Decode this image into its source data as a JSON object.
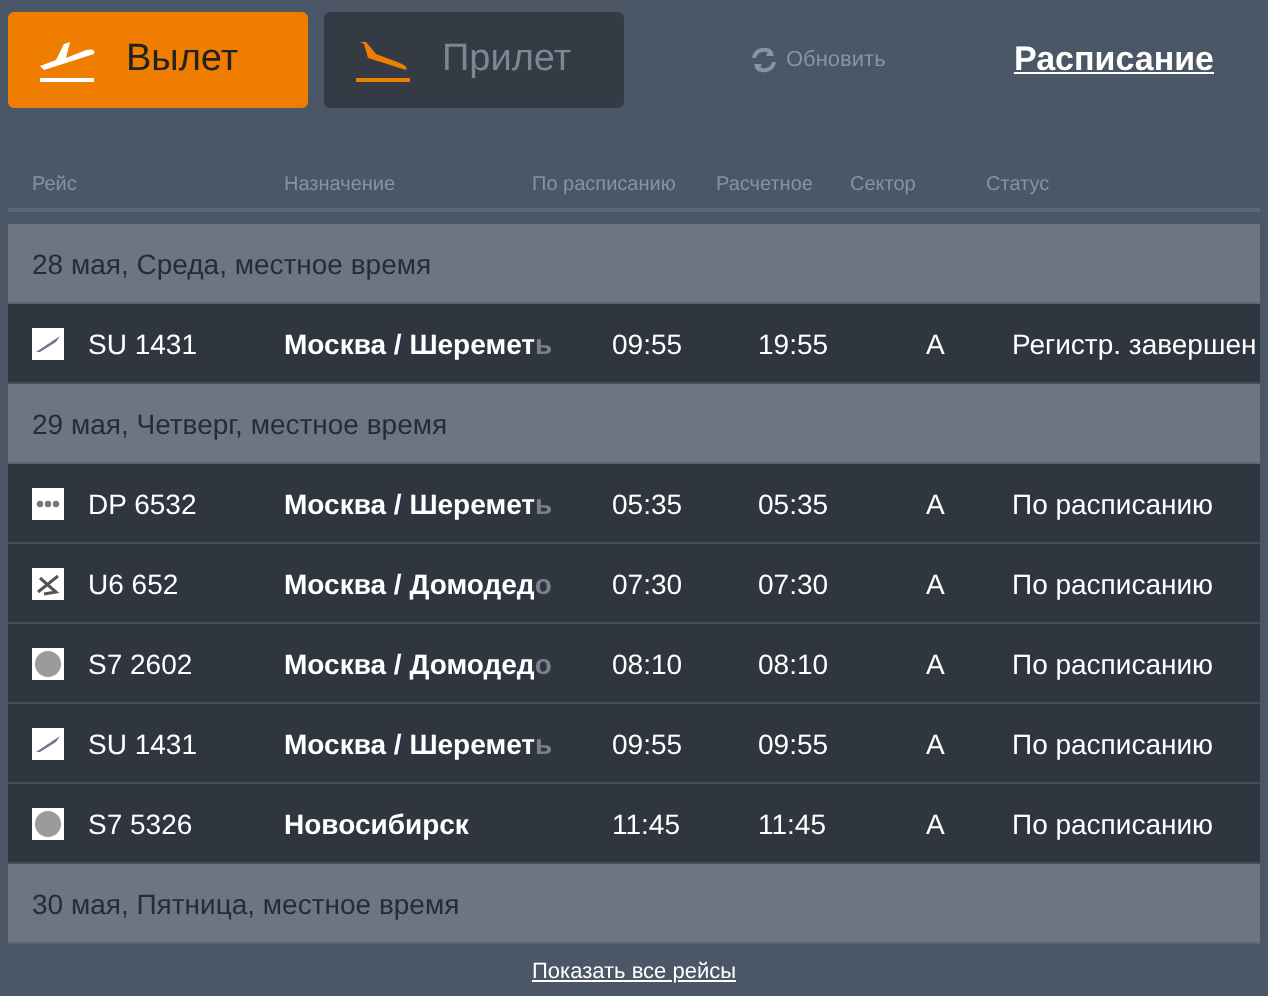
{
  "tabs": [
    {
      "label": "Вылет",
      "kind": "departure",
      "selected": true
    },
    {
      "label": "Прилет",
      "kind": "arrival",
      "selected": false
    }
  ],
  "refresh": "Обновить",
  "schedule_link": "Расписание",
  "table": {
    "columns": [
      "Рейс",
      "Назначение",
      "По расписанию",
      "Расчетное",
      "Сектор",
      "Статус"
    ],
    "groups": [
      {
        "date": "28 мая, Среда, местное время",
        "rows": [
          {
            "kind": "plane",
            "flight": "SU 1431",
            "destination": "Москва / Шеремет",
            "fade": "ь",
            "scheduled": "09:55",
            "estimated": "19:55",
            "sector": "A",
            "status": "Регистр. завершен"
          }
        ]
      },
      {
        "date": "29 мая, Четверг, местное время",
        "rows": [
          {
            "kind": "dots",
            "flight": "DP 6532",
            "destination": "Москва / Шеремет",
            "fade": "ь",
            "scheduled": "05:35",
            "estimated": "05:35",
            "sector": "A",
            "status": "По расписанию"
          },
          {
            "kind": "swirl",
            "flight": "U6 652",
            "destination": "Москва / Домодед",
            "fade": "о",
            "scheduled": "07:30",
            "estimated": "07:30",
            "sector": "A",
            "status": "По расписанию"
          },
          {
            "kind": "circle",
            "flight": "S7 2602",
            "destination": "Москва / Домодед",
            "fade": "о",
            "scheduled": "08:10",
            "estimated": "08:10",
            "sector": "A",
            "status": "По расписанию"
          },
          {
            "kind": "plane",
            "flight": "SU 1431",
            "destination": "Москва / Шеремет",
            "fade": "ь",
            "scheduled": "09:55",
            "estimated": "09:55",
            "sector": "A",
            "status": "По расписанию"
          },
          {
            "kind": "circle",
            "flight": "S7 5326",
            "destination": "Новосибирск",
            "scheduled": "11:45",
            "estimated": "11:45",
            "sector": "A",
            "status": "По расписанию"
          }
        ]
      },
      {
        "date": "30 мая, Пятница, местное время"
      }
    ]
  },
  "show_all": "Показать все рейсы"
}
